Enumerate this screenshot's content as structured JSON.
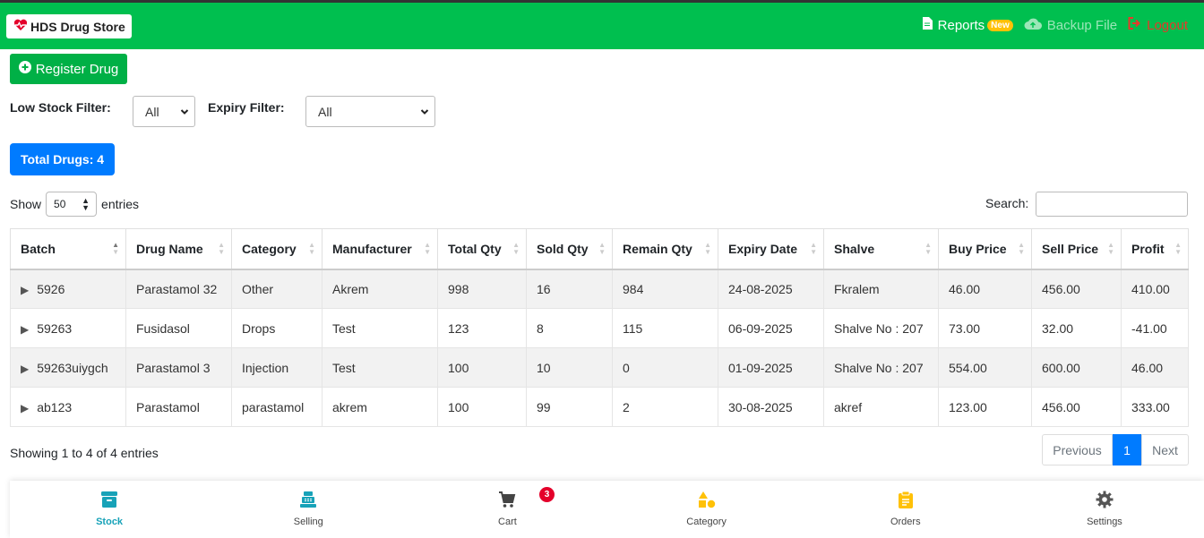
{
  "navbar": {
    "brand": "HDS Drug Store",
    "reports_label": "Reports",
    "reports_badge": "New",
    "backup_label": "Backup File",
    "logout_label": "Logout"
  },
  "actions": {
    "register_label": "Register Drug"
  },
  "filters": {
    "low_stock_label": "Low Stock Filter:",
    "low_stock_value": "All",
    "expiry_label": "Expiry Filter:",
    "expiry_value": "All"
  },
  "total_badge": "Total Drugs: 4",
  "table_controls": {
    "show_label": "Show",
    "entries_value": "50",
    "entries_label": "entries",
    "search_label": "Search:",
    "search_value": ""
  },
  "table": {
    "columns": [
      "Batch",
      "Drug Name",
      "Category",
      "Manufacturer",
      "Total Qty",
      "Sold Qty",
      "Remain Qty",
      "Expiry Date",
      "Shalve",
      "Buy Price",
      "Sell Price",
      "Profit"
    ],
    "rows": [
      [
        "5926",
        "Parastamol 32",
        "Other",
        "Akrem",
        "998",
        "16",
        "984",
        "24-08-2025",
        "Fkralem",
        "46.00",
        "456.00",
        "410.00"
      ],
      [
        "59263",
        "Fusidasol",
        "Drops",
        "Test",
        "123",
        "8",
        "115",
        "06-09-2025",
        "Shalve No : 207",
        "73.00",
        "32.00",
        "-41.00"
      ],
      [
        "59263uiygch",
        "Parastamol 3",
        "Injection",
        "Test",
        "100",
        "10",
        "0",
        "01-09-2025",
        "Shalve No : 207",
        "554.00",
        "600.00",
        "46.00"
      ],
      [
        "ab123",
        "Parastamol",
        "parastamol",
        "akrem",
        "100",
        "99",
        "2",
        "30-08-2025",
        "akref",
        "123.00",
        "456.00",
        "333.00"
      ]
    ]
  },
  "footer": {
    "info": "Showing 1 to 4 of 4 entries",
    "prev_label": "Previous",
    "current_page": "1",
    "next_label": "Next"
  },
  "bottom_nav": {
    "items": [
      {
        "label": "Stock",
        "icon": "archive-icon",
        "color": "#17a2b8"
      },
      {
        "label": "Selling",
        "icon": "cash-register-icon",
        "color": "#17a2b8"
      },
      {
        "label": "Cart",
        "icon": "cart-icon",
        "color": "#444444"
      },
      {
        "label": "Category",
        "icon": "shapes-icon",
        "color": "#ffc107"
      },
      {
        "label": "Orders",
        "icon": "clipboard-icon",
        "color": "#ffc107"
      },
      {
        "label": "Settings",
        "icon": "gear-icon",
        "color": "#555555"
      }
    ],
    "cart_count": "3"
  },
  "colors": {
    "navbar": "#00bf4f",
    "primary": "#007bff",
    "register": "#00b046",
    "logout": "#e8382a",
    "badge_new": "#ffc107"
  }
}
